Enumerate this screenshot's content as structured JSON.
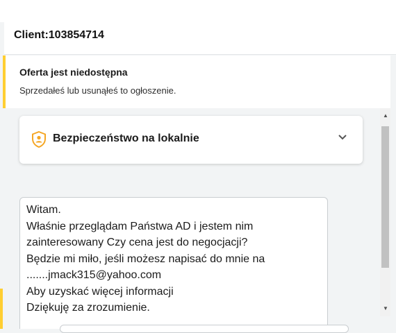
{
  "client": {
    "label": "Client:103854714"
  },
  "offer_notice": {
    "title": "Oferta jest niedostępna",
    "subtitle": "Sprzedałeś lub usunąłeś to ogłoszenie."
  },
  "safety_panel": {
    "title": "Bezpieczeństwo na lokalnie",
    "icon": "shield-user-icon"
  },
  "message": {
    "lines": [
      "Witam.",
      "Właśnie przeglądam Państwa AD i jestem nim",
      "zainteresowany Czy cena jest do negocjacji?",
      "Będzie mi miło, jeśli możesz napisać do mnie na",
      ".......jmack315@yahoo.com",
      "Aby uzyskać więcej informacji",
      "Dziękuję za zrozumienie."
    ]
  },
  "colors": {
    "accent": "#ffce32"
  }
}
